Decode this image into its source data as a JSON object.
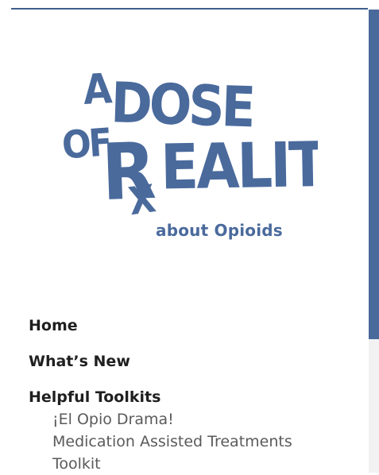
{
  "logo": {
    "words": {
      "a": "A",
      "dose": "DOSE",
      "of": "OF",
      "r": "R",
      "rx_x": "X",
      "eality": "EALITY"
    },
    "subtitle": "about Opioids",
    "color": "#4a6a9c"
  },
  "nav": {
    "items": [
      {
        "label": "Home"
      },
      {
        "label": "What’s New"
      },
      {
        "label": "Helpful Toolkits"
      }
    ],
    "subitems": [
      {
        "label": "¡El Opio Drama!"
      },
      {
        "label": "Medication Assisted Treatments"
      },
      {
        "label": "Toolkit"
      }
    ]
  },
  "colors": {
    "accent": "#4a6a9c",
    "nav_text": "#1f1f1f",
    "sub_text": "#5a5a5a",
    "scroll_track": "#f2f2f2"
  }
}
